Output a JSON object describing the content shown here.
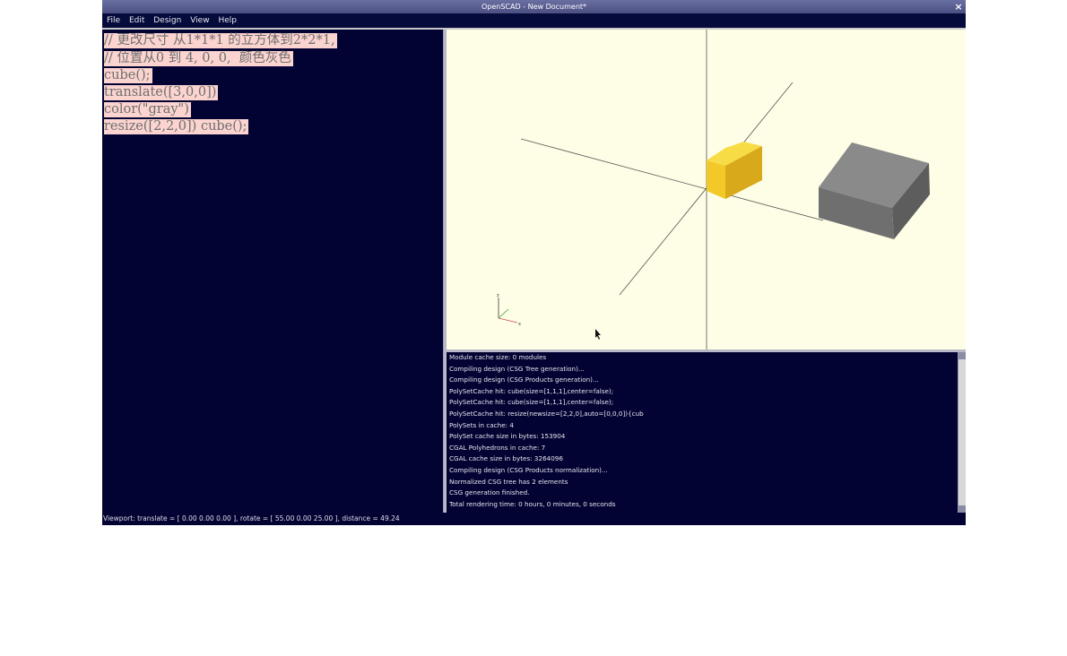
{
  "window": {
    "title": "OpenSCAD - New Document*",
    "close_label": "×"
  },
  "menu": {
    "items": [
      "File",
      "Edit",
      "Design",
      "View",
      "Help"
    ]
  },
  "editor": {
    "lines": [
      "// 更改尺寸 从1*1*1 的立方体到2*2*1,",
      "// 位置从0 到 4, 0, 0,  颜色灰色",
      "cube();",
      "translate([3,0,0])",
      "color(\"gray\")",
      "resize([2,2,0]) cube();"
    ]
  },
  "viewport": {
    "background": "#fefee6",
    "axis_indicator": {
      "x": "x",
      "z": "z"
    },
    "objects": [
      {
        "name": "yellow-cube",
        "color": "#f2c928"
      },
      {
        "name": "gray-box",
        "color": "#7a7a7a"
      }
    ]
  },
  "console": {
    "lines": [
      "Module cache size: 0 modules",
      "Compiling design (CSG Tree generation)...",
      "Compiling design (CSG Products generation)...",
      "PolySetCache hit: cube(size=[1,1,1],center=false);",
      "PolySetCache hit: cube(size=[1,1,1],center=false);",
      "PolySetCache hit: resize(newsize=[2,2,0],auto=[0,0,0]){cub",
      "PolySets in cache: 4",
      "PolySet cache size in bytes: 153904",
      "CGAL Polyhedrons in cache: 7",
      "CGAL cache size in bytes: 3264096",
      "Compiling design (CSG Products normalization)...",
      "Normalized CSG tree has 2 elements",
      "CSG generation finished.",
      "Total rendering time: 0 hours, 0 minutes, 0 seconds"
    ]
  },
  "status": {
    "text": "Viewport: translate = [ 0.00 0.00 0.00 ], rotate = [ 55.00 0.00 25.00 ], distance = 49.24"
  }
}
